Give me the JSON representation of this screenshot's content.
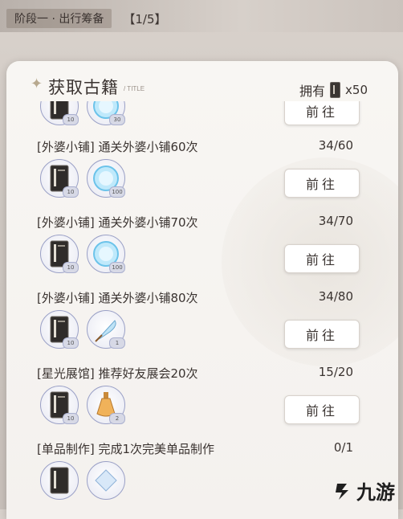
{
  "stage": {
    "name": "阶段一 · 出行筹备",
    "count": "【1/5】"
  },
  "panel": {
    "title": "获取古籍",
    "title_sub": "/ TITLE",
    "own_label": "拥有",
    "own_count": "x50"
  },
  "tasks": [
    {
      "label": "",
      "progress": "",
      "button": "前往",
      "rewards": [
        {
          "icon": "ancient-book-icon",
          "qty": "10"
        },
        {
          "icon": "crystal-orb-icon",
          "qty": "30"
        }
      ]
    },
    {
      "label": "[外婆小铺] 通关外婆小铺60次",
      "progress": "34/60",
      "button": "前往",
      "rewards": [
        {
          "icon": "ancient-book-icon",
          "qty": "10"
        },
        {
          "icon": "crystal-orb-icon",
          "qty": "100"
        }
      ]
    },
    {
      "label": "[外婆小铺] 通关外婆小铺70次",
      "progress": "34/70",
      "button": "前往",
      "rewards": [
        {
          "icon": "ancient-book-icon",
          "qty": "10"
        },
        {
          "icon": "crystal-orb-icon",
          "qty": "100"
        }
      ]
    },
    {
      "label": "[外婆小铺] 通关外婆小铺80次",
      "progress": "34/80",
      "button": "前往",
      "rewards": [
        {
          "icon": "ancient-book-icon",
          "qty": "10"
        },
        {
          "icon": "feather-quill-icon",
          "qty": "1"
        }
      ]
    },
    {
      "label": "[星光展馆] 推荐好友展会20次",
      "progress": "15/20",
      "button": "前往",
      "rewards": [
        {
          "icon": "ancient-book-icon",
          "qty": "10"
        },
        {
          "icon": "golden-flask-icon",
          "qty": "2"
        }
      ]
    },
    {
      "label": "[单品制作] 完成1次完美单品制作",
      "progress": "0/1",
      "button": "",
      "rewards": [
        {
          "icon": "ancient-book-icon",
          "qty": ""
        },
        {
          "icon": "crystal-gem-icon",
          "qty": ""
        }
      ]
    }
  ],
  "watermark": "九游",
  "colors": {
    "accent": "#9aa0c6",
    "text": "#3a3330",
    "panel_bg": "#f6f3f0"
  }
}
